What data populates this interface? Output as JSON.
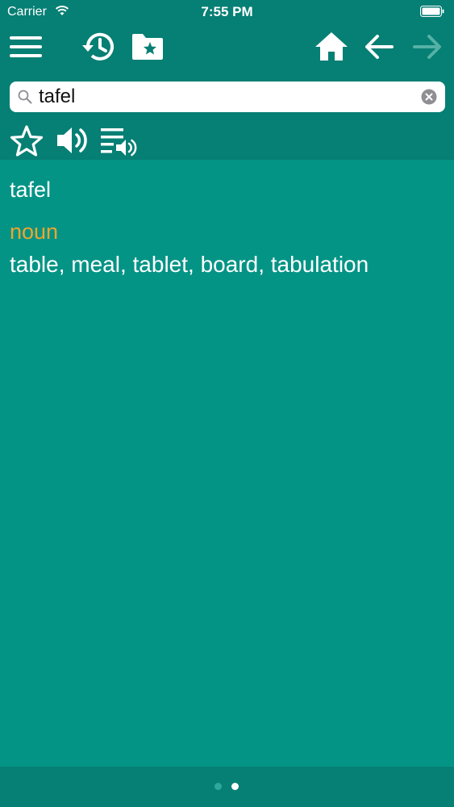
{
  "status_bar": {
    "carrier": "Carrier",
    "time": "7:55 PM"
  },
  "toolbar": {
    "icons": [
      "menu-icon",
      "history-icon",
      "favorites-folder-icon",
      "home-icon",
      "back-arrow-icon",
      "forward-arrow-icon"
    ],
    "forward_enabled": false
  },
  "search": {
    "value": "tafel",
    "placeholder": ""
  },
  "actions": {
    "icons": [
      "star-icon",
      "speaker-icon",
      "playlist-audio-icon"
    ]
  },
  "entry": {
    "headword": "tafel",
    "part_of_speech": "noun",
    "translation": "table, meal, tablet, board, tabulation"
  },
  "pager": {
    "page_count": 2,
    "current_page": 2
  },
  "colors": {
    "background": "#049486",
    "bar": "#067f74",
    "part_of_speech": "#f0a52c"
  }
}
